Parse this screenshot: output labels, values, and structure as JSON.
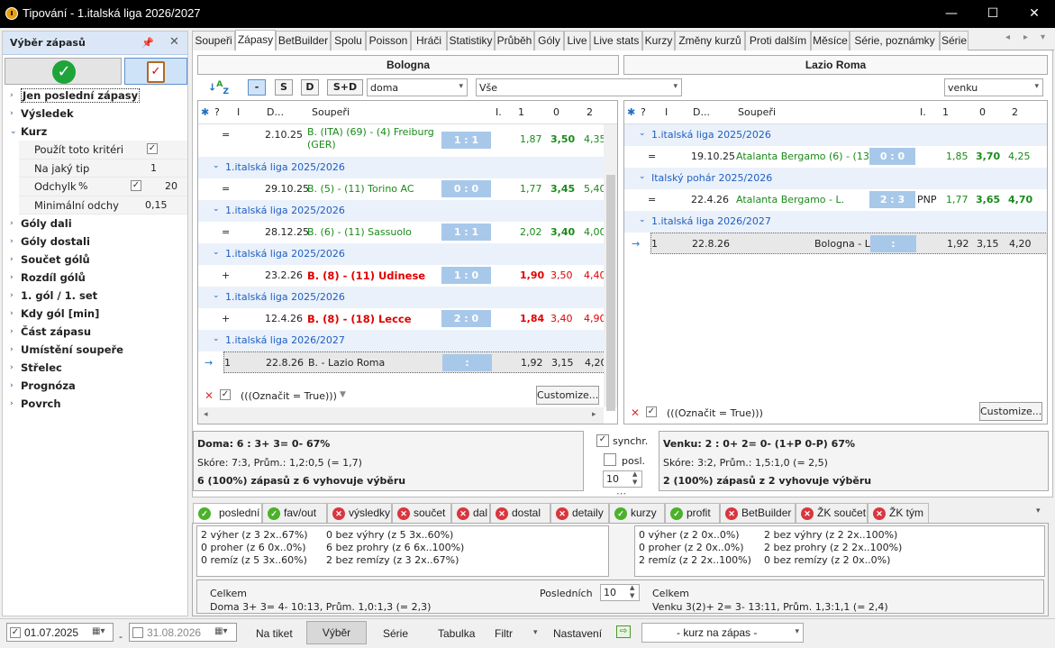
{
  "window": {
    "title": "Tipování - 1.italská liga 2026/2027"
  },
  "left": {
    "title": "Výběr zápasů",
    "criteria": [
      {
        "label": "Jen poslední zápasy"
      },
      {
        "label": "Výsledek"
      },
      {
        "label": "Kurz"
      }
    ],
    "kurz": {
      "use_label": "Použít toto kritéri",
      "tip_label": "Na jaký tip",
      "tip_value": "1",
      "dev_label": "Odchylk",
      "dev_unit": "%",
      "dev_value": "20",
      "min_label": "Minimální odchy",
      "min_value": "0,15"
    },
    "criteria2": [
      {
        "label": "Góly dali"
      },
      {
        "label": "Góly dostali"
      },
      {
        "label": "Součet gólů"
      },
      {
        "label": "Rozdíl gólů"
      },
      {
        "label": "1. gól / 1. set"
      },
      {
        "label": "Kdy gól [min]"
      },
      {
        "label": "Část zápasu"
      },
      {
        "label": "Umístění soupeře"
      },
      {
        "label": "Střelec"
      },
      {
        "label": "Prognóza"
      },
      {
        "label": "Povrch"
      }
    ]
  },
  "tabs": [
    "Soupeři",
    "Zápasy",
    "BetBuilder",
    "Spolu",
    "Poisson",
    "Hráči",
    "Statistiky",
    "Průběh",
    "Góly",
    "Live",
    "Live stats",
    "Kurzy",
    "Změny kurzů",
    "Proti dalším",
    "Měsíce",
    "Série, poznámky",
    "Série"
  ],
  "home": {
    "team": "Bologna",
    "filter_buttons": [
      "-",
      "S",
      "D",
      "S+D"
    ],
    "venue": "doma",
    "scope": "Vše",
    "headers": [
      "?",
      "I",
      "D...",
      "Soupeři",
      "I.",
      "1",
      "0",
      "2"
    ],
    "filter_text": "(((Označit = True)))",
    "customize": "Customize..."
  },
  "away": {
    "team": "Lazio Roma",
    "venue": "venku",
    "filter_text": "(((Označit = True)))",
    "customize": "Customize..."
  },
  "home_rows": [
    {
      "type": "row",
      "sign": "=",
      "round": "2",
      "date": "2.10.25",
      "match": "B. (ITA) (69) - (4) Freiburg",
      "match2": "(GER)",
      "score": "1 : 1",
      "o1": "1,87",
      "o0": "3,50",
      "o2": "4,35",
      "style": "green"
    },
    {
      "type": "grp",
      "label": "1.italská liga 2025/2026"
    },
    {
      "type": "row",
      "sign": "=",
      "round": "9",
      "date": "29.10.25",
      "match": "B. (5) - (11) Torino AC",
      "score": "0 : 0",
      "o1": "1,77",
      "o0": "3,45",
      "o2": "5,40",
      "style": "green"
    },
    {
      "type": "grp",
      "label": "1.italská liga 2025/2026"
    },
    {
      "type": "row",
      "sign": "=",
      "round": "17",
      "date": "28.12.25",
      "match": "B. (6) - (11) Sassuolo",
      "score": "1 : 1",
      "o1": "2,02",
      "o0": "3,40",
      "o2": "4,00",
      "style": "green"
    },
    {
      "type": "grp",
      "label": "1.italská liga 2025/2026"
    },
    {
      "type": "row",
      "sign": "+",
      "round": "26",
      "date": "23.2.26",
      "match": "B. (8) - (11) Udinese",
      "score": "1 : 0",
      "o1": "1,90",
      "o0": "3,50",
      "o2": "4,40",
      "style": "red"
    },
    {
      "type": "grp",
      "label": "1.italská liga 2025/2026"
    },
    {
      "type": "row",
      "sign": "+",
      "round": "32",
      "date": "12.4.26",
      "match": "B. (8) - (18) Lecce",
      "score": "2 : 0",
      "o1": "1,84",
      "o0": "3,40",
      "o2": "4,90",
      "style": "red"
    },
    {
      "type": "grp",
      "label": "1.italská liga 2026/2027"
    },
    {
      "type": "row",
      "sign": "",
      "round": "1",
      "date": "22.8.26",
      "match": "B. - Lazio Roma",
      "score": ":",
      "o1": "1,92",
      "o0": "3,15",
      "o2": "4,20",
      "style": "plain"
    }
  ],
  "away_rows": [
    {
      "type": "grp",
      "label": "1.italská liga 2025/2026"
    },
    {
      "type": "row",
      "sign": "=",
      "round": "7",
      "date": "19.10.25",
      "match": "Atalanta Bergamo (6) - (13) L.",
      "score": "0 : 0",
      "o1": "1,85",
      "o0": "3,70",
      "o2": "4,25",
      "style": "green"
    },
    {
      "type": "grp",
      "label": "Italský pohár 2025/2026"
    },
    {
      "type": "row",
      "sign": "=",
      "round": "1/2",
      "date": "22.4.26",
      "match": "Atalanta Bergamo - L.",
      "score": "2 : 3",
      "ex": "PNP",
      "o1": "1,77",
      "o0": "3,65",
      "o2": "4,70",
      "style": "green"
    },
    {
      "type": "grp",
      "label": "1.italská liga 2026/2027"
    },
    {
      "type": "row",
      "sign": "",
      "round": "1",
      "date": "22.8.26",
      "match": "Bologna - L.",
      "score": ":",
      "o1": "1,92",
      "o0": "3,15",
      "o2": "4,20",
      "style": "plain"
    }
  ],
  "summary": {
    "home_l1": "Doma: 6 : 3+  3=  0-  67%",
    "home_l2": "Skóre: 7:3, Prům.: 1,2:0,5 (= 1,7)",
    "home_l3": "6 (100%) zápasů z 6 vyhovuje výběru",
    "synchr": "synchr.",
    "posl": "posl.",
    "posl_value": "10",
    "away_l1": "Venku: 2 : 0+  2=  0-  (1+P  0-P)  67%",
    "away_l2": "Skóre: 3:2, Prům.: 1,5:1,0 (= 2,5)",
    "away_l3": "2 (100%) zápasů z 2 vyhovuje výběru"
  },
  "btabs": [
    {
      "label": "poslední",
      "ok": true
    },
    {
      "label": "fav/out",
      "ok": true
    },
    {
      "label": "výsledky",
      "ok": false
    },
    {
      "label": "součet",
      "ok": false
    },
    {
      "label": "dal",
      "ok": false
    },
    {
      "label": "dostal",
      "ok": false
    },
    {
      "label": "detaily",
      "ok": false
    },
    {
      "label": "kurzy",
      "ok": true
    },
    {
      "label": "profit",
      "ok": true
    },
    {
      "label": "BetBuilder",
      "ok": false
    },
    {
      "label": "ŽK součet",
      "ok": false
    },
    {
      "label": "ŽK tým",
      "ok": false
    }
  ],
  "details": {
    "h_a": [
      "2 výher (z 3 2x..67%)",
      "0 proher (z 6 0x..0%)",
      "0 remíz (z 5 3x..60%)"
    ],
    "h_b": [
      "0 bez výhry (z 5 3x..60%)",
      "6 bez prohry (z 6 6x..100%)",
      "2 bez remízy (z 3 2x..67%)"
    ],
    "a_a": [
      "0 výher (z 2 0x..0%)",
      "0 proher (z 2 0x..0%)",
      "2 remíz (z 2 2x..100%)"
    ],
    "a_b": [
      "2 bez výhry (z 2 2x..100%)",
      "2 bez prohry (z 2 2x..100%)",
      "0 bez remízy (z 2 0x..0%)"
    ]
  },
  "totals": {
    "celkem": "Celkem",
    "doma": "Doma  3+  3=  4-   10:13,  Prům. 1,0:1,3 (= 2,3)",
    "poslednich": "Posledních",
    "posl_value": "10",
    "celkem2": "Celkem",
    "venku": "Venku    3(2)+  2=   3-   13:11,  Prům. 1,3:1,1 (= 2,4)"
  },
  "statusbar": {
    "date_from": "01.07.2025",
    "date_to": "31.08.2026",
    "na_tiket": "Na tiket",
    "vyber": "Výběr",
    "serie": "Série",
    "tabulka": "Tabulka",
    "filtr": "Filtr",
    "nastaveni": "Nastavení",
    "kurz": "- kurz na zápas -"
  }
}
